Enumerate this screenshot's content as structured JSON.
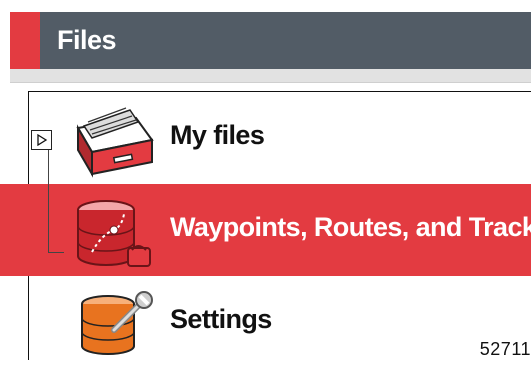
{
  "header": {
    "title": "Files"
  },
  "items": [
    {
      "label": "My files",
      "icon": "drawer-icon",
      "expandable": true
    },
    {
      "label": "Waypoints, Routes, and Tracks",
      "icon": "waypoints-database-icon",
      "selected": true
    },
    {
      "label": "Settings",
      "icon": "settings-database-icon"
    }
  ],
  "figure_number": "52711",
  "colors": {
    "accent": "#e33b41",
    "header_bg": "#525c66",
    "header_text": "#ffffff"
  }
}
